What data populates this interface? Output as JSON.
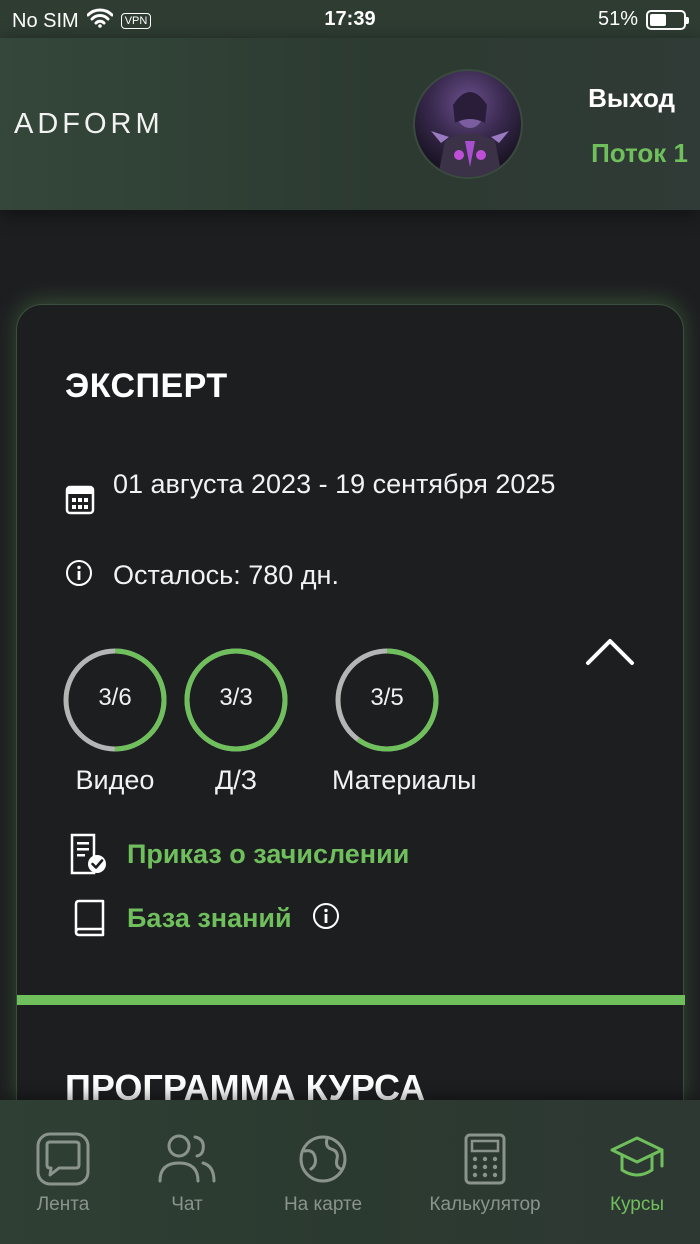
{
  "status_bar": {
    "carrier": "No SIM",
    "vpn": "VPN",
    "time": "17:39",
    "battery": "51%",
    "battery_level": 0.51
  },
  "header": {
    "logo": "ADFORM",
    "exit_label": "Выход",
    "stream_label": "Поток 1"
  },
  "course": {
    "title": "ЭКСПЕРТ",
    "dates": "01 августа 2023 - 19 сентября 2025",
    "remaining": "Осталось: 780 дн.",
    "progress": [
      {
        "label": "3/6",
        "caption": "Видео",
        "done": 3,
        "total": 6
      },
      {
        "label": "3/3",
        "caption": "Д/З",
        "done": 3,
        "total": 3
      },
      {
        "label": "3/5",
        "caption": "Материалы",
        "done": 3,
        "total": 5
      }
    ],
    "links": {
      "enrollment_order": "Приказ о зачислении",
      "knowledge_base": "База знаний"
    },
    "program_title": "ПРОГРАММА КУРСА"
  },
  "nav": [
    {
      "label": "Лента",
      "icon": "feed-icon",
      "active": false
    },
    {
      "label": "Чат",
      "icon": "chat-users-icon",
      "active": false
    },
    {
      "label": "На карте",
      "icon": "globe-icon",
      "active": false
    },
    {
      "label": "Калькулятор",
      "icon": "calculator-icon",
      "active": false
    },
    {
      "label": "Курсы",
      "icon": "graduation-cap-icon",
      "active": true
    }
  ],
  "colors": {
    "accent": "#6fbf5c",
    "ring_track": "#b5b5b5",
    "nav_inactive": "#8a948c"
  }
}
